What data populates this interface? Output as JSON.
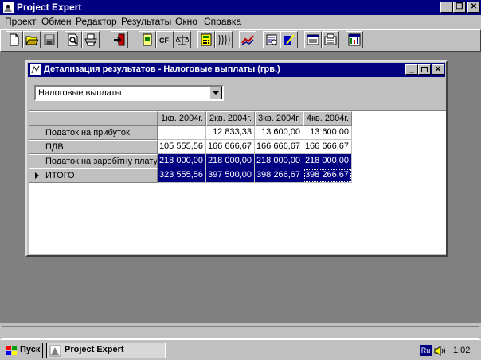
{
  "app": {
    "title": "Project Expert"
  },
  "menu": [
    "Проект",
    "Обмен",
    "Редактор",
    "Результаты",
    "Окно",
    "Справка"
  ],
  "caption_buttons": {
    "minimize": "_",
    "restore": "❐",
    "close": "✕"
  },
  "toolbar": {
    "cf_label": "CF",
    "buttons": [
      "new-icon",
      "open-folder-icon",
      "save-disk-icon",
      "print-preview-icon",
      "print-icon",
      "exit-door-icon",
      "notebook-icon",
      "cashflow-icon",
      "balance-icon",
      "calculator-icon",
      "calendar-spiral-icon",
      "line-chart-icon",
      "report-icon",
      "pen-edit-icon",
      "document-list-icon",
      "folder-doc-icon",
      "grid-table-icon"
    ]
  },
  "child_window": {
    "title": "Детализация результатов - Налоговые выплаты (грв.)",
    "combo_value": "Налоговые выплаты"
  },
  "table": {
    "columns": [
      "1кв. 2004г.",
      "2кв. 2004г.",
      "3кв. 2004г.",
      "4кв. 2004г."
    ],
    "rows": [
      {
        "label": "Податок на прибуток",
        "values": [
          "",
          "12 833,33",
          "13 600,00",
          "13 600,00"
        ],
        "selected": false,
        "marker": false
      },
      {
        "label": "ПДВ",
        "values": [
          "105 555,56",
          "166 666,67",
          "166 666,67",
          "166 666,67"
        ],
        "selected": false,
        "marker": false
      },
      {
        "label": "Податок на заробітну плату",
        "values": [
          "218 000,00",
          "218 000,00",
          "218 000,00",
          "218 000,00"
        ],
        "selected": true,
        "marker": false
      },
      {
        "label": "ИТОГО",
        "values": [
          "323 555,56",
          "397 500,00",
          "398 266,67",
          "398 266,67"
        ],
        "selected": true,
        "marker": true
      }
    ]
  },
  "taskbar": {
    "start_label": "Пуск",
    "task_label": "Project Expert",
    "lang": "Ru",
    "clock": "1:02"
  },
  "colors": {
    "titlebar": "#000080",
    "face": "#c0c0c0",
    "workspace": "#808080",
    "selection": "#000080"
  }
}
